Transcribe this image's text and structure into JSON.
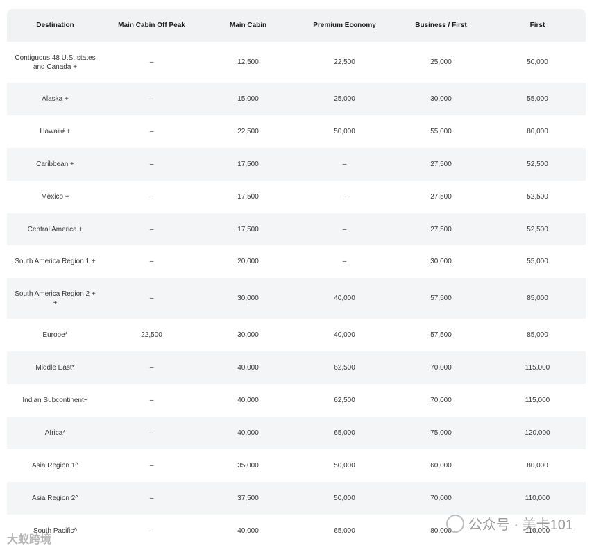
{
  "table": {
    "headers": [
      "Destination",
      "Main Cabin Off Peak",
      "Main Cabin",
      "Premium Economy",
      "Business / First",
      "First"
    ],
    "rows": [
      [
        "Contiguous 48 U.S. states and Canada +",
        "–",
        "12,500",
        "22,500",
        "25,000",
        "50,000"
      ],
      [
        "Alaska +",
        "–",
        "15,000",
        "25,000",
        "30,000",
        "55,000"
      ],
      [
        "Hawaii# +",
        "–",
        "22,500",
        "50,000",
        "55,000",
        "80,000"
      ],
      [
        "Caribbean +",
        "–",
        "17,500",
        "–",
        "27,500",
        "52,500"
      ],
      [
        "Mexico +",
        "–",
        "17,500",
        "–",
        "27,500",
        "52,500"
      ],
      [
        "Central America +",
        "–",
        "17,500",
        "–",
        "27,500",
        "52,500"
      ],
      [
        "South America Region 1 +",
        "–",
        "20,000",
        "–",
        "30,000",
        "55,000"
      ],
      [
        "South America Region 2 + +",
        "–",
        "30,000",
        "40,000",
        "57,500",
        "85,000"
      ],
      [
        "Europe*",
        "22,500",
        "30,000",
        "40,000",
        "57,500",
        "85,000"
      ],
      [
        "Middle East*",
        "–",
        "40,000",
        "62,500",
        "70,000",
        "115,000"
      ],
      [
        "Indian Subcontinent~",
        "–",
        "40,000",
        "62,500",
        "70,000",
        "115,000"
      ],
      [
        "Africa*",
        "–",
        "40,000",
        "65,000",
        "75,000",
        "120,000"
      ],
      [
        "Asia Region 1^",
        "–",
        "35,000",
        "50,000",
        "60,000",
        "80,000"
      ],
      [
        "Asia Region 2^",
        "–",
        "37,500",
        "50,000",
        "70,000",
        "110,000"
      ],
      [
        "South Pacific^",
        "–",
        "40,000",
        "65,000",
        "80,000",
        "110,000"
      ]
    ]
  },
  "watermark": {
    "right_text": "公众号 · 美卡101",
    "left_text": "大蚁跨境"
  }
}
